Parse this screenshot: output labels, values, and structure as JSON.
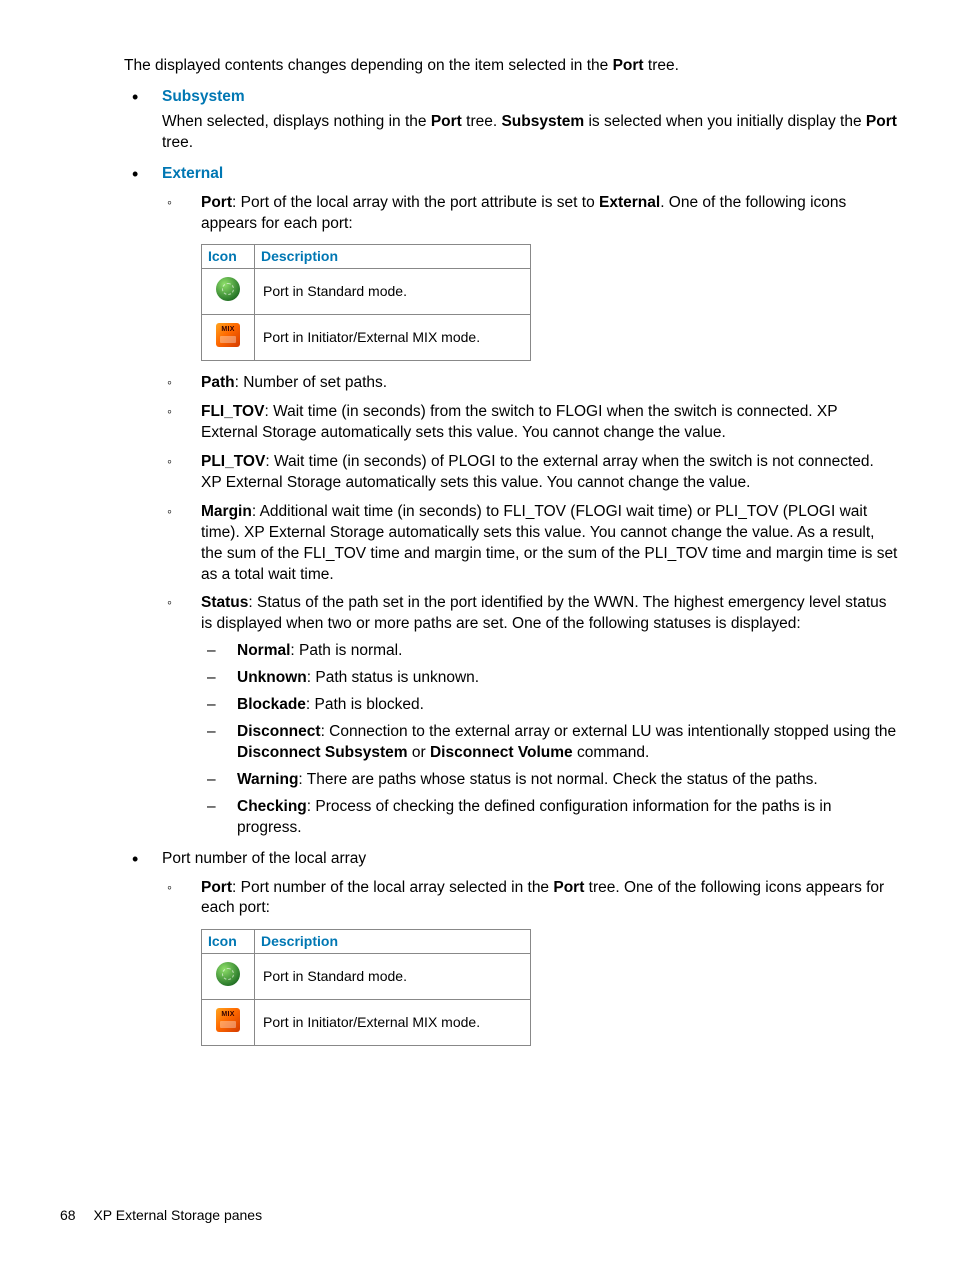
{
  "intro": {
    "pre": "The displayed contents changes depending on the item selected in the ",
    "bold": "Port",
    "post": " tree."
  },
  "subsystem": {
    "title": "Subsystem",
    "desc": {
      "p1": "When selected, displays nothing in the ",
      "b1": "Port",
      "p2": " tree. ",
      "b2": "Subsystem",
      "p3": " is selected when you initially display the ",
      "b3": "Port",
      "p4": " tree."
    }
  },
  "external": {
    "title": "External",
    "port": {
      "label": "Port",
      "p1": ": Port of the local array with the port attribute is set to ",
      "b1": "External",
      "p2": ". One of the following icons appears for each port:"
    },
    "table": {
      "h_icon": "Icon",
      "h_desc": "Description",
      "rows": [
        {
          "name": "standard-mode-icon",
          "desc": "Port in Standard mode."
        },
        {
          "name": "mix-mode-icon",
          "desc": "Port in Initiator/External MIX mode."
        }
      ]
    },
    "path": {
      "label": "Path",
      "text": ": Number of set paths."
    },
    "fli_tov": {
      "label": "FLI_TOV",
      "text": ": Wait time (in seconds) from the switch to FLOGI when the switch is connected. XP External Storage automatically sets this value. You cannot change the value."
    },
    "pli_tov": {
      "label": "PLI_TOV",
      "text": ": Wait time (in seconds) of PLOGI to the external array when the switch is not connected. XP External Storage automatically sets this value. You cannot change the value."
    },
    "margin": {
      "label": "Margin",
      "text": ": Additional wait time (in seconds) to FLI_TOV (FLOGI wait time) or PLI_TOV (PLOGI wait time). XP External Storage automatically sets this value. You cannot change the value. As a result, the sum of the FLI_TOV time and margin time, or the sum of the PLI_TOV time and margin time is set as a total wait time."
    },
    "status": {
      "label": "Status",
      "text": ": Status of the path set in the port identified by the WWN. The highest emergency level status is displayed when two or more paths are set. One of the following statuses is displayed:",
      "items": {
        "normal": {
          "label": "Normal",
          "text": ": Path is normal."
        },
        "unknown": {
          "label": "Unknown",
          "text": ": Path status is unknown."
        },
        "blockade": {
          "label": "Blockade",
          "text": ": Path is blocked."
        },
        "disconnect": {
          "label": "Disconnect",
          "p1": ": Connection to the external array or external LU was intentionally stopped using the ",
          "b1": "Disconnect Subsystem",
          "p2": " or ",
          "b2": "Disconnect Volume",
          "p3": " command."
        },
        "warning": {
          "label": "Warning",
          "text": ": There are paths whose status is not normal. Check the status of the paths."
        },
        "checking": {
          "label": "Checking",
          "text": ": Process of checking the defined configuration information for the paths is in progress."
        }
      }
    }
  },
  "portnum": {
    "title": "Port number of the local array",
    "port": {
      "label": "Port",
      "p1": ": Port number of the local array selected in the ",
      "b1": "Port",
      "p2": " tree. One of the following icons appears for each port:"
    }
  },
  "footer": {
    "page": "68",
    "title": "XP External Storage panes"
  }
}
